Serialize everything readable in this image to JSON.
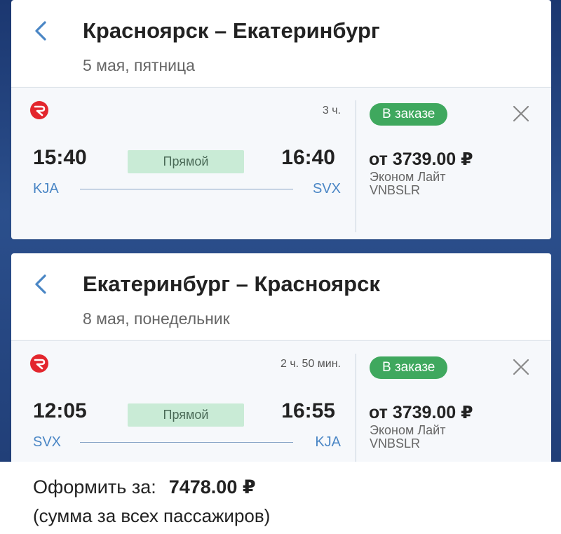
{
  "flights": [
    {
      "route": "Красноярск – Екатеринбург",
      "date": "5 мая, пятница",
      "duration": "3 ч.",
      "departure_time": "15:40",
      "arrival_time": "16:40",
      "departure_code": "KJA",
      "arrival_code": "SVX",
      "direct_label": "Прямой",
      "status_label": "В заказе",
      "price": "от 3739.00 ₽",
      "fare_name": "Эконом Лайт",
      "fare_code": "VNBSLR"
    },
    {
      "route": "Екатеринбург – Красноярск",
      "date": "8 мая, понедельник",
      "duration": "2 ч. 50 мин.",
      "departure_time": "12:05",
      "arrival_time": "16:55",
      "departure_code": "SVX",
      "arrival_code": "KJA",
      "direct_label": "Прямой",
      "status_label": "В заказе",
      "price": "от 3739.00 ₽",
      "fare_name": "Эконом Лайт",
      "fare_code": "VNBSLR"
    }
  ],
  "footer": {
    "label": "Оформить за:",
    "amount": "7478.00 ₽",
    "note": "(сумма за всех пассажиров)"
  },
  "icons": {
    "back": "chevron-left-icon",
    "airline": "airline-logo-icon",
    "close": "close-icon"
  },
  "colors": {
    "accent": "#4a86c5",
    "status_green": "#3fa85e",
    "direct_badge": "#c9ebd6",
    "airline_red": "#e3262d"
  }
}
